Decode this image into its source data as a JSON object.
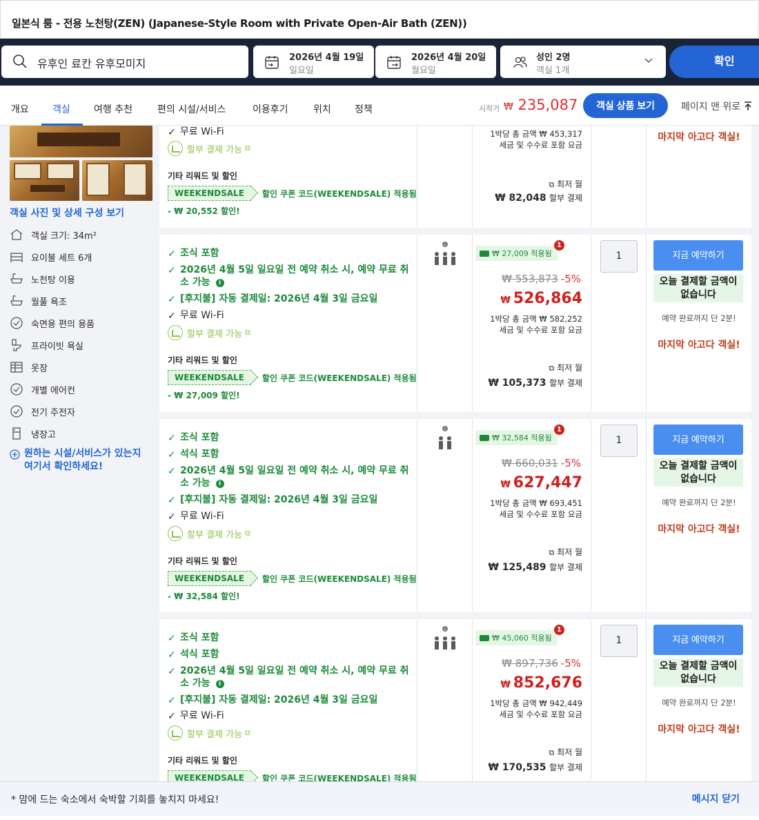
{
  "title": "일본식 룸 - 전용 노천탕(ZEN) (Japanese-Style Room with Private Open-Air Bath (ZEN))",
  "search": {
    "destination": "유후인 료칸 유후모미지",
    "checkin_date": "2026년 4월 19일",
    "checkin_day": "일요일",
    "checkout_date": "2026년 4월 20일",
    "checkout_day": "월요일",
    "guests": "성인 2명",
    "rooms": "객실 1개",
    "confirm": "확인"
  },
  "nav": {
    "tabs": [
      "개요",
      "객실",
      "여행 추천",
      "편의 시설/서비스",
      "이용후기",
      "위치",
      "정책"
    ],
    "from_label": "시작가",
    "from_currency": "₩",
    "from_price": "235,087",
    "view_rooms": "객실 상품 보기",
    "back_to_top": "페이지 맨 위로"
  },
  "left": {
    "view_detail": "객실 사진 및 상세 구성 보기",
    "facilities": [
      "객실 크기: 34m²",
      "요이불 세트 6개",
      "노천탕 이용",
      "월풀 욕조",
      "숙면용 편의 용품",
      "프라이빗 욕실",
      "옷장",
      "개별 에어컨",
      "전기 주전자",
      "냉장고"
    ],
    "facility_icons": [
      "house-icon",
      "bed-icon",
      "bath-icon",
      "bath-icon",
      "check-circle-icon",
      "toilet-icon",
      "wardrobe-icon",
      "check-circle-icon",
      "check-circle-icon",
      "fridge-icon"
    ],
    "ask": "원하는 시설/서비스가 있는지 여기서 확인하세요!"
  },
  "offer0": {
    "wifi": "무료 Wi-Fi",
    "installment": "할부 결제 가능",
    "rewards_title": "기타 리워드 및 할인",
    "coupon_tag": "WEEKENDSALE",
    "coupon_text": "할인 쿠폰 코드(WEEKENDSALE) 적용됨",
    "saving": "- ₩ 20,552 할인!",
    "per_night": "1박당 총 금액 ₩ 453,317",
    "tax_note": "세금 및 수수료 포함 요금",
    "min_monthly": "최저 월",
    "inst_amount": "₩ 82,048",
    "inst_label": "할부 결제",
    "last_room": "마지막 아고다 객실!"
  },
  "offer1": {
    "feat1": "조식 포함",
    "feat2": "2026년 4월 5일 일요일 전 예약 취소 시, 예약 무료 취소 가능",
    "feat3": "[후지불] 자동 결제일: 2026년 4월 3일 금요일",
    "wifi": "무료 Wi-Fi",
    "installment": "할부 결제 가능",
    "rewards_title": "기타 리워드 및 할인",
    "coupon_tag": "WEEKENDSALE",
    "coupon_text": "할인 쿠폰 코드(WEEKENDSALE) 적용됨",
    "saving": "- ₩ 27,009 할인!",
    "applied": "₩ 27,009 적용됨",
    "badge": "1",
    "orig_price": "₩ 553,873",
    "discount_pct": "-5%",
    "currency": "₩",
    "final_price": "526,864",
    "per_night": "1박당 총 금액 ₩ 582,252",
    "tax_note": "세금 및 수수료 포함 요금",
    "min_monthly": "최저 월",
    "inst_amount": "₩ 105,373",
    "inst_label": "할부 결제",
    "qty": "1",
    "book": "지금 예약하기",
    "pay_today": "오늘 결제할 금액이 없습니다",
    "steps": "예약 완료까지 단 2분!",
    "last_room": "마지막 아고다 객실!"
  },
  "offer2": {
    "feat1": "조식 포함",
    "feat1b": "석식 포함",
    "feat2": "2026년 4월 5일 일요일 전 예약 취소 시, 예약 무료 취소 가능",
    "feat3": "[후지불] 자동 결제일: 2026년 4월 3일 금요일",
    "wifi": "무료 Wi-Fi",
    "installment": "할부 결제 가능",
    "rewards_title": "기타 리워드 및 할인",
    "coupon_tag": "WEEKENDSALE",
    "coupon_text": "할인 쿠폰 코드(WEEKENDSALE) 적용됨",
    "saving": "- ₩ 32,584 할인!",
    "applied": "₩ 32,584 적용됨",
    "badge": "1",
    "orig_price": "₩ 660,031",
    "discount_pct": "-5%",
    "currency": "₩",
    "final_price": "627,447",
    "per_night": "1박당 총 금액 ₩ 693,451",
    "tax_note": "세금 및 수수료 포함 요금",
    "min_monthly": "최저 월",
    "inst_amount": "₩ 125,489",
    "inst_label": "할부 결제",
    "qty": "1",
    "book": "지금 예약하기",
    "pay_today": "오늘 결제할 금액이 없습니다",
    "steps": "예약 완료까지 단 2분!",
    "last_room": "마지막 아고다 객실!"
  },
  "offer3": {
    "feat1": "조식 포함",
    "feat1b": "석식 포함",
    "feat2": "2026년 4월 5일 일요일 전 예약 취소 시, 예약 무료 취소 가능",
    "feat3": "[후지불] 자동 결제일: 2026년 4월 3일 금요일",
    "wifi": "무료 Wi-Fi",
    "installment": "할부 결제 가능",
    "rewards_title": "기타 리워드 및 할인",
    "coupon_tag": "WEEKENDSALE",
    "coupon_text": "할인 쿠폰 코드(WEEKENDSALE) 적용됨",
    "applied": "₩ 45,060 적용됨",
    "badge": "1",
    "orig_price": "₩ 897,736",
    "discount_pct": "-5%",
    "currency": "₩",
    "final_price": "852,676",
    "per_night": "1박당 총 금액 ₩ 942,449",
    "tax_note": "세금 및 수수료 포함 요금",
    "min_monthly": "최저 월",
    "inst_amount": "₩ 170,535",
    "inst_label": "할부 결제",
    "qty": "1",
    "book": "지금 예약하기",
    "pay_today": "오늘 결제할 금액이 없습니다",
    "steps": "예약 완료까지 단 2분!",
    "last_room": "마지막 아고다 객실!"
  },
  "banner": {
    "message": "* 맘에 드는 숙소에서 숙박할 기회를 놓치지 마세요!",
    "close": "메시지 닫기"
  },
  "colors": {
    "brand_blue": "#2365d4",
    "price_red": "#d0201e",
    "green": "#1c8a3a",
    "header_navy": "#1a2438"
  }
}
